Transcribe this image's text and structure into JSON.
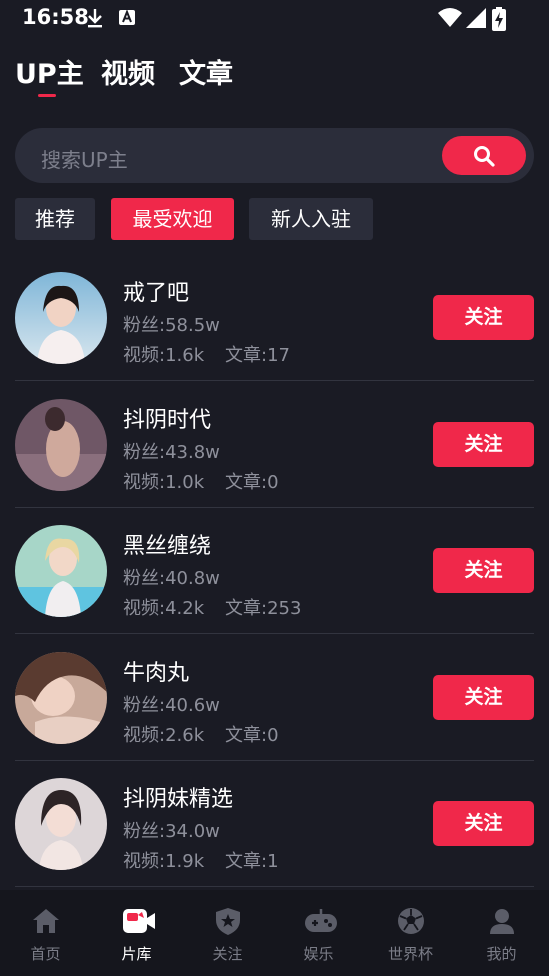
{
  "status_bar": {
    "time": "16:58"
  },
  "tabs": [
    {
      "label": "UP主",
      "active": true
    },
    {
      "label": "视频",
      "active": false
    },
    {
      "label": "文章",
      "active": false
    }
  ],
  "search": {
    "placeholder": "搜索UP主",
    "icon": "search-icon"
  },
  "filters": [
    {
      "label": "推荐",
      "active": false
    },
    {
      "label": "最受欢迎",
      "active": true
    },
    {
      "label": "新人入驻",
      "active": false
    }
  ],
  "creators": [
    {
      "name": "戒了吧",
      "fans": "粉丝:58.5w",
      "videos": "视频:1.6k",
      "articles": "文章:17",
      "follow_label": "关注"
    },
    {
      "name": "抖阴时代",
      "fans": "粉丝:43.8w",
      "videos": "视频:1.0k",
      "articles": "文章:0",
      "follow_label": "关注"
    },
    {
      "name": "黑丝缠绕",
      "fans": "粉丝:40.8w",
      "videos": "视频:4.2k",
      "articles": "文章:253",
      "follow_label": "关注"
    },
    {
      "name": "牛肉丸",
      "fans": "粉丝:40.6w",
      "videos": "视频:2.6k",
      "articles": "文章:0",
      "follow_label": "关注"
    },
    {
      "name": "抖阴妹精选",
      "fans": "粉丝:34.0w",
      "videos": "视频:1.9k",
      "articles": "文章:1",
      "follow_label": "关注"
    }
  ],
  "bottom_nav": [
    {
      "label": "首页",
      "icon": "home-icon",
      "active": false
    },
    {
      "label": "片库",
      "icon": "video-library-icon",
      "active": true
    },
    {
      "label": "关注",
      "icon": "star-shield-icon",
      "active": false
    },
    {
      "label": "娱乐",
      "icon": "gamepad-icon",
      "active": false
    },
    {
      "label": "世界杯",
      "icon": "soccer-ball-icon",
      "active": false
    },
    {
      "label": "我的",
      "icon": "profile-icon",
      "active": false
    }
  ],
  "colors": {
    "accent": "#f0284a",
    "background": "#1a1b24",
    "surface": "#2b2d3a"
  }
}
